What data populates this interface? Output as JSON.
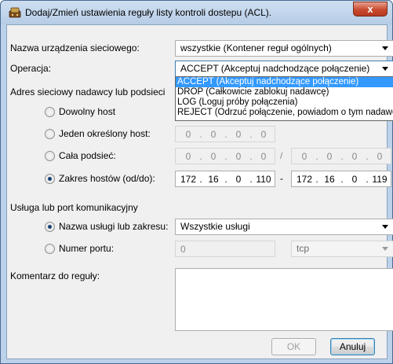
{
  "window": {
    "title": "Dodaj/Zmień ustawienia reguły listy kontroli dostepu (ACL).",
    "close_label": "x"
  },
  "device": {
    "label": "Nazwa urządzenia sieciowego:",
    "value": "wszystkie (Kontener reguł ogólnych)"
  },
  "operation": {
    "label": "Operacja:",
    "value": "ACCEPT (Akceptuj nadchodzące połączenie)",
    "options": [
      "ACCEPT (Akceptuj nadchodzące połączenie)",
      "DROP (Całkowicie zablokuj nadawcę)",
      "LOG (Loguj próby połączenia)",
      "REJECT (Odrzuć połączenie, powiadom o tym nadawcę)"
    ]
  },
  "address": {
    "section_label": "Adres sieciowy nadawcy lub podsieci",
    "any_host_label": "Dowolny host",
    "single_host_label": "Jeden określony host:",
    "subnet_label": "Cała podsieć:",
    "range_label": "Zakres hostów (od/do):",
    "single_host_ip": [
      "0",
      "0",
      "0",
      "0"
    ],
    "subnet_ip": [
      "0",
      "0",
      "0",
      "0"
    ],
    "subnet_mask": [
      "0",
      "0",
      "0",
      "0"
    ],
    "range_from": [
      "172",
      "16",
      "0",
      "110"
    ],
    "range_to": [
      "172",
      "16",
      "0",
      "119"
    ],
    "dot": ".",
    "slash": "/",
    "dash": "-"
  },
  "service": {
    "section_label": "Usługa lub port komunikacyjny",
    "name_label": "Nazwa usługi lub zakresu:",
    "name_value": "Wszystkie usługi",
    "port_label": "Numer portu:",
    "port_value": "0",
    "protocol_value": "tcp"
  },
  "comment": {
    "label": "Komentarz do reguły:",
    "value": ""
  },
  "buttons": {
    "ok": "OK",
    "cancel": "Anuluj"
  }
}
